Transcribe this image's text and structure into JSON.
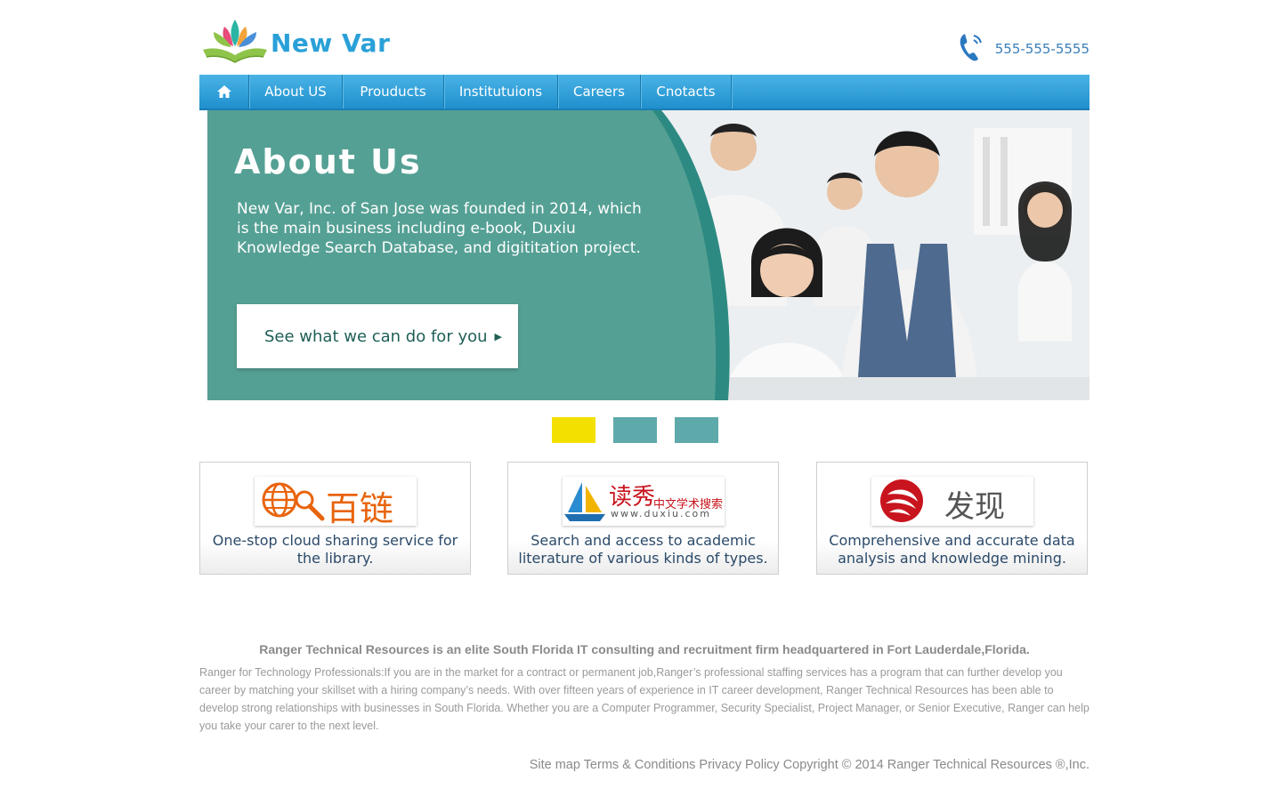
{
  "brand": {
    "name": "New Var"
  },
  "contact": {
    "phone": "555-555-5555"
  },
  "nav": {
    "items": [
      "About US",
      "Prouducts",
      "Institutuions",
      "Careers",
      "Cnotacts"
    ]
  },
  "hero": {
    "title": "About Us",
    "description": "New Var, Inc. of San Jose was founded in 2014, which is the main business including e-book, Duxiu Knowledge Search Database, and digititation project.",
    "button_label": "See what we can do for you"
  },
  "slider": {
    "dot_count": 3,
    "active_index": 0,
    "active_color": "#f4e000",
    "inactive_color": "#5ea9a9"
  },
  "cards": [
    {
      "logo_text": "百链",
      "description": "One-stop cloud sharing service for the library."
    },
    {
      "logo_text": "读秀",
      "logo_subtext": "中文学术搜索",
      "logo_url": "www.duxiu.com",
      "description": "Search and access to academic literature of various kinds of types."
    },
    {
      "logo_text": "发现",
      "description": "Comprehensive and accurate data analysis and knowledge mining."
    }
  ],
  "footer": {
    "headline": "Ranger Technical Resources is an elite South Florida IT consulting and recruitment firm headquartered in Fort Lauderdale,Florida.",
    "body": "Ranger for Technology Professionals:If you are in the market for a contract or permanent job,Ranger’s professional staffing services has a program that can further develop you career by matching your skillset with a hiring company’s needs. With over fifteen years of experience in IT career development, Ranger Technical Resources has been able to develop strong relationships with businesses in South Florida. Whether you are a Computer Programmer, Security Specialist, Project Manager, or Senior Executive, Ranger can help you take your carer to the next level.",
    "links": "Site map Terms & Conditions Privacy Policy Copyright © 2014 Ranger Technical Resources ®,Inc."
  },
  "colors": {
    "nav": "#2aa0d8",
    "hero_green": "#4f9d91",
    "brand_blue": "#2aa0d8"
  }
}
